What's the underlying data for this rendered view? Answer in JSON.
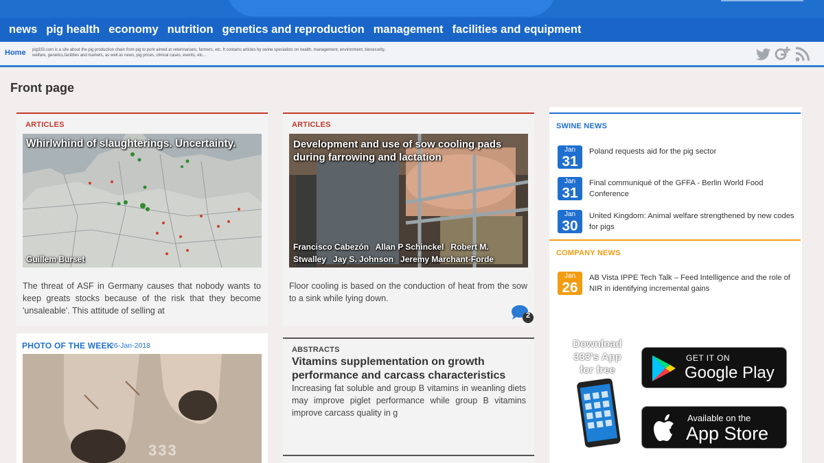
{
  "nav": {
    "items": [
      "news",
      "pig health",
      "economy",
      "nutrition",
      "genetics and reproduction",
      "management",
      "facilities and equipment"
    ]
  },
  "breadcrumb": {
    "home": "Home",
    "description": "pig333.com is a site about the pig production chain from pig to pork aimed at veterinarians, farmers, etc. It contains articles by swine specialists on health, management, environment, biosecurity, welfare, genetics,facilities and markets, as well as news, pig prices, clinical cases, events, etc..."
  },
  "social": {
    "twitter": "twitter-icon",
    "googleplus": "google-plus-icon",
    "rss": "rss-icon"
  },
  "page": {
    "title": "Front page"
  },
  "cards": {
    "article1": {
      "label": "ARTICLES",
      "title": "Whirlwhind of slaughterings. Uncertainty.",
      "author": "Guillem Burset",
      "excerpt": "The threat of ASF in Germany causes that nobody wants to keep greats stocks because of the risk that they become 'unsaleable'. This attitude of selling at"
    },
    "article2": {
      "label": "ARTICLES",
      "title": "Development and use of sow cooling pads during farrowing and lactation",
      "authors_line1": "Francisco Cabezón   Allan P Schinckel   Robert M.",
      "authors_line2": "Stwalley   Jay S. Johnson   Jeremy Marchant-Forde",
      "excerpt": "Floor cooling is based on the conduction of heat from the sow to a sink while lying down.",
      "comments": "2"
    },
    "photo": {
      "label": "PHOTO OF THE WEEK",
      "date": "26-Jan-2018",
      "watermark": "333"
    },
    "abstract": {
      "label": "ABSTRACTS",
      "title": "Vitamins supplementation on growth performance and carcass characteristics",
      "excerpt": "Increasing fat soluble and group B vitamins in weanling diets may improve piglet performance while group B vitamins improve carcass quality in g"
    }
  },
  "sidebar": {
    "swine_news": {
      "label": "SWINE NEWS",
      "items": [
        {
          "month": "Jan",
          "day": "31",
          "text": "Poland requests aid for the pig sector"
        },
        {
          "month": "Jan",
          "day": "31",
          "text": "Final communiqué of the GFFA - Berlin World Food Conference"
        },
        {
          "month": "Jan",
          "day": "30",
          "text": "United Kingdom: Animal welfare strengthened by new codes for pigs"
        }
      ]
    },
    "company_news": {
      "label": "COMPANY NEWS",
      "items": [
        {
          "month": "Jan",
          "day": "26",
          "text": "AB Vista IPPE Tech Talk – Feed Intelligence and the role of NIR in identifying incremental gains"
        }
      ]
    },
    "app": {
      "promo_line1": "Download",
      "promo_line2": "333's App",
      "promo_line3": "for free",
      "google_small": "GET IT ON",
      "google_big": "Google Play",
      "apple_small": "Available on the",
      "apple_big": "App Store"
    }
  },
  "colors": {
    "nav_blue": "#1a66c8",
    "articles_red": "#c0392b",
    "swine_blue": "#1f6fcf",
    "company_orange": "#f39c12"
  }
}
